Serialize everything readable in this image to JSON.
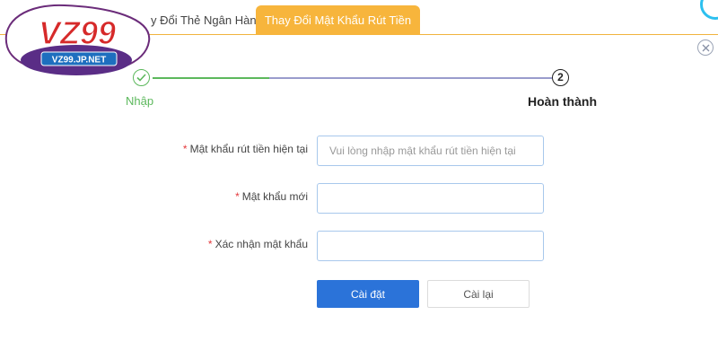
{
  "logo": {
    "brand": "VZ99",
    "domain": "VZ99.JP.NET",
    "icon": "vz99-logo"
  },
  "tabs": [
    {
      "label": "y Đổi Thẻ Ngân Hàng",
      "active": false
    },
    {
      "label": "Thay Đổi Mật Khẩu Rút Tiền",
      "active": true
    }
  ],
  "close": {
    "icon": "close-icon"
  },
  "steps": [
    {
      "label": "Nhập",
      "status": "done",
      "icon": "check-icon"
    },
    {
      "number": "2",
      "label": "Hoàn thành",
      "status": "current"
    }
  ],
  "form": {
    "current_password": {
      "required_mark": "*",
      "label": "Mật khẩu rút tiền hiện tại",
      "placeholder": "Vui lòng nhập mật khẩu rút tiền hiện tại",
      "value": ""
    },
    "new_password": {
      "required_mark": "*",
      "label": "Mật khẩu mới",
      "placeholder": "",
      "value": ""
    },
    "confirm_password": {
      "required_mark": "*",
      "label": "Xác nhận mật khẩu",
      "placeholder": "",
      "value": ""
    },
    "submit_label": "Cài đặt",
    "reset_label": "Cài lại"
  },
  "colors": {
    "tab_active": "#f7b53c",
    "step_done": "#5cb85c",
    "primary_button": "#2b73d9",
    "required": "#e4393c"
  }
}
